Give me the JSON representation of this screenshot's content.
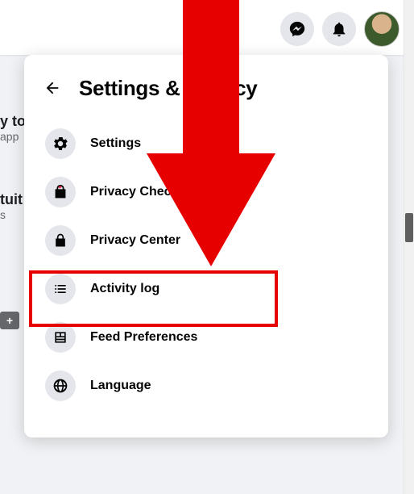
{
  "header": {
    "title": "Settings & privacy"
  },
  "menu": {
    "items": [
      {
        "label": "Settings"
      },
      {
        "label": "Privacy Checkup"
      },
      {
        "label": "Privacy Center"
      },
      {
        "label": "Activity log"
      },
      {
        "label": "Feed Preferences"
      },
      {
        "label": "Language"
      }
    ]
  },
  "background": {
    "row1_title": "y to",
    "row1_sub": "app",
    "row2_title": "tuit",
    "row2_sub": "s"
  },
  "annotation": {
    "highlighted_item_index": 3
  }
}
